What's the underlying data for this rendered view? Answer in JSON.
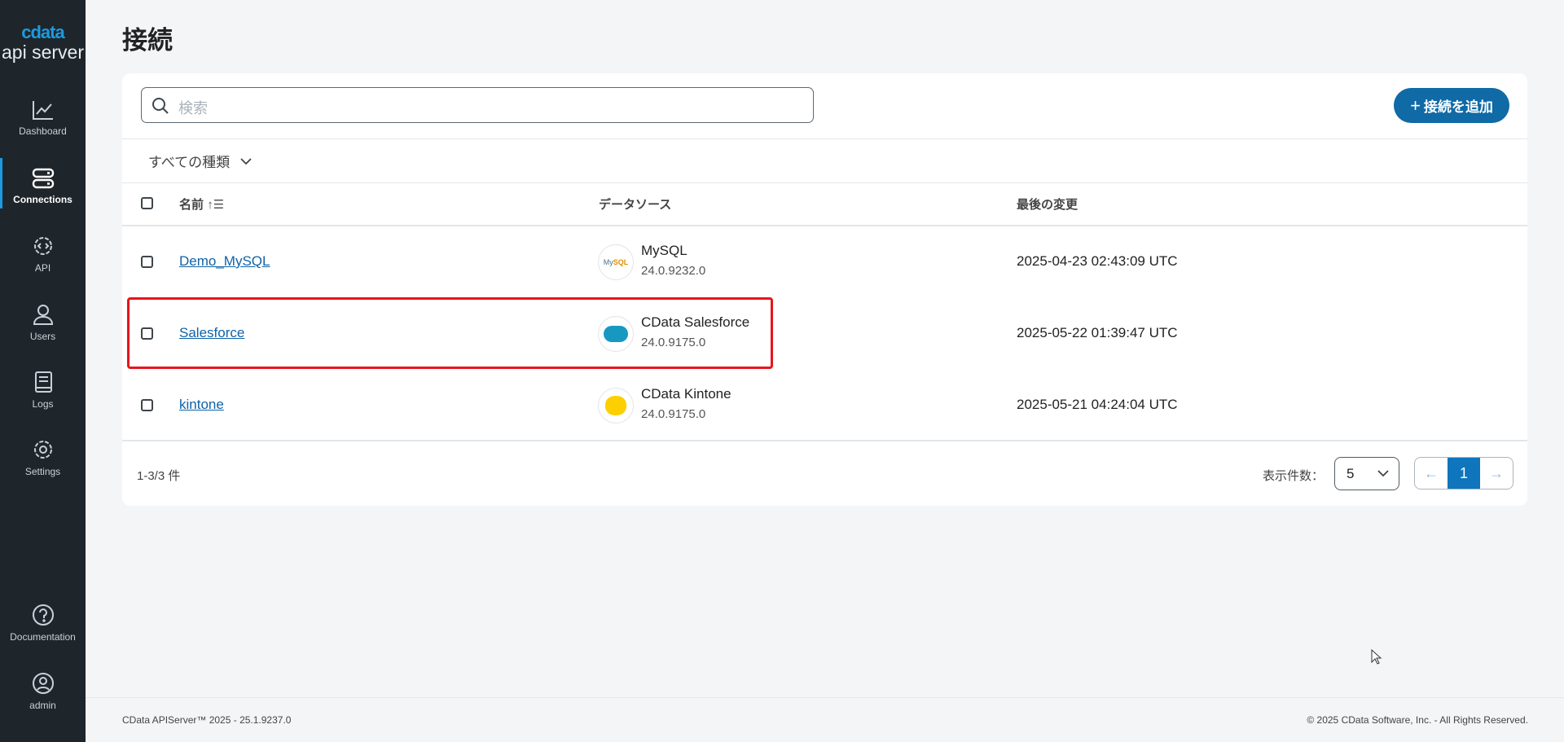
{
  "sidebar": {
    "logo_brand": "cdata",
    "logo_product": "api server",
    "items": [
      {
        "label": "Dashboard",
        "icon": "chart-icon"
      },
      {
        "label": "Connections",
        "icon": "server-icon",
        "active": true
      },
      {
        "label": "API",
        "icon": "api-gear-icon"
      },
      {
        "label": "Users",
        "icon": "user-icon"
      },
      {
        "label": "Logs",
        "icon": "book-icon"
      },
      {
        "label": "Settings",
        "icon": "gear-icon"
      }
    ],
    "bottom": [
      {
        "label": "Documentation",
        "icon": "help-icon"
      },
      {
        "label": "admin",
        "icon": "account-icon"
      }
    ]
  },
  "page": {
    "title": "接続"
  },
  "toolbar": {
    "search_placeholder": "検索",
    "add_label": "接続を追加",
    "filter_label": "すべての種類"
  },
  "table": {
    "headers": {
      "name": "名前",
      "datasource": "データソース",
      "modified": "最後の変更"
    },
    "rows": [
      {
        "name": "Demo_MySQL",
        "ds_name": "MySQL",
        "ds_version": "24.0.9232.0",
        "modified": "2025-04-23 02:43:09 UTC",
        "logo": "mysql-logo-icon"
      },
      {
        "name": "Salesforce",
        "ds_name": "CData Salesforce",
        "ds_version": "24.0.9175.0",
        "modified": "2025-05-22 01:39:47 UTC",
        "logo": "salesforce-logo-icon"
      },
      {
        "name": "kintone",
        "ds_name": "CData Kintone",
        "ds_version": "24.0.9175.0",
        "modified": "2025-05-21 04:24:04 UTC",
        "logo": "kintone-logo-icon"
      }
    ]
  },
  "pagination": {
    "count": "1-3/3 件",
    "per_page_label": "表示件数：",
    "per_page": "5",
    "current_page": "1"
  },
  "footer": {
    "left": "CData APIServer™ 2025 - 25.1.9237.0",
    "right": "© 2025 CData Software, Inc. - All Rights Reserved."
  },
  "colors": {
    "accent": "#0f6aa6",
    "sidebar": "#1f262b",
    "highlight": "#e8141c"
  }
}
